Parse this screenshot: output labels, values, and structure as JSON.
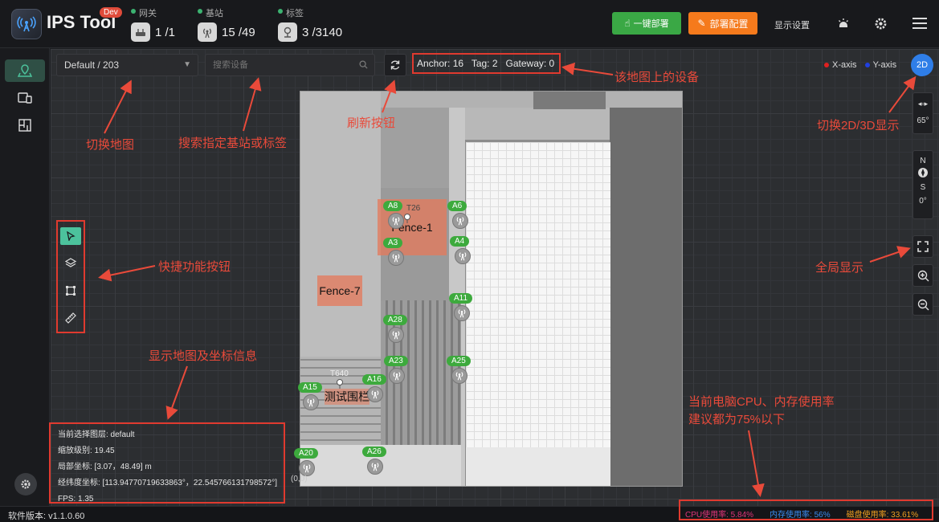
{
  "app": {
    "title": "IPS Tool",
    "badge": "Dev"
  },
  "header": {
    "stats": [
      {
        "label": "网关",
        "value": "1 /1"
      },
      {
        "label": "基站",
        "value": "15 /49"
      },
      {
        "label": "标签",
        "value": "3 /3140"
      }
    ],
    "deploy_button": "一键部署",
    "config_button": "部署配置",
    "display_settings": "显示设置"
  },
  "toolbar": {
    "map_select": "Default / 203",
    "search_placeholder": "搜索设备",
    "device_counts": "Anchor: 16   Tag: 2   Gateway: 0",
    "x_axis": "X-axis",
    "y_axis": "Y-axis",
    "view_mode": "2D"
  },
  "controls": {
    "rotation": "65°",
    "compass_n": "N",
    "compass_s": "S",
    "compass_deg": "0°"
  },
  "info": {
    "layer": "当前选择图层:  default",
    "zoom": "缩放级别:  19.45",
    "local": "局部坐标:  [3.07，48.49] m",
    "lnglat": "经纬度坐标:  [113.94770719633863°，22.545766131798572°]",
    "fps": "FPS:  1.35",
    "origin": "(0,0)"
  },
  "footer": {
    "version": "软件版本:  v1.1.0.60",
    "cpu": "CPU使用率:  5.84%",
    "mem": "内存使用率:  56%",
    "disk": "磁盘使用率:  33.61%",
    "cpu_color": "#e0357a",
    "mem_color": "#3a8cf0",
    "disk_color": "#f0a020"
  },
  "map": {
    "fences": [
      "Fence-1",
      "Fence-7",
      "测试围栏"
    ],
    "tags": [
      "T26",
      "T640"
    ],
    "anchors": [
      "A8",
      "A6",
      "A3",
      "A4",
      "A11",
      "A28",
      "A23",
      "A25",
      "A16",
      "A15",
      "A20",
      "A26"
    ]
  },
  "annotations": {
    "switch_map": "切换地图",
    "search": "搜索指定基站或标签",
    "refresh": "刷新按钮",
    "devices": "该地图上的设备",
    "toggle_view": "切换2D/3D显示",
    "quick_tools": "快捷功能按钮",
    "fullview": "全局显示",
    "map_info": "显示地图及坐标信息",
    "usage_line1": "当前电脑CPU、内存使用率",
    "usage_line2": "建议都为75%以下"
  },
  "colors": {
    "accent_green": "#3aa845",
    "accent_orange": "#f57a1c",
    "annotation_red": "#e03a2f",
    "view_blue": "#2f7ee8"
  }
}
